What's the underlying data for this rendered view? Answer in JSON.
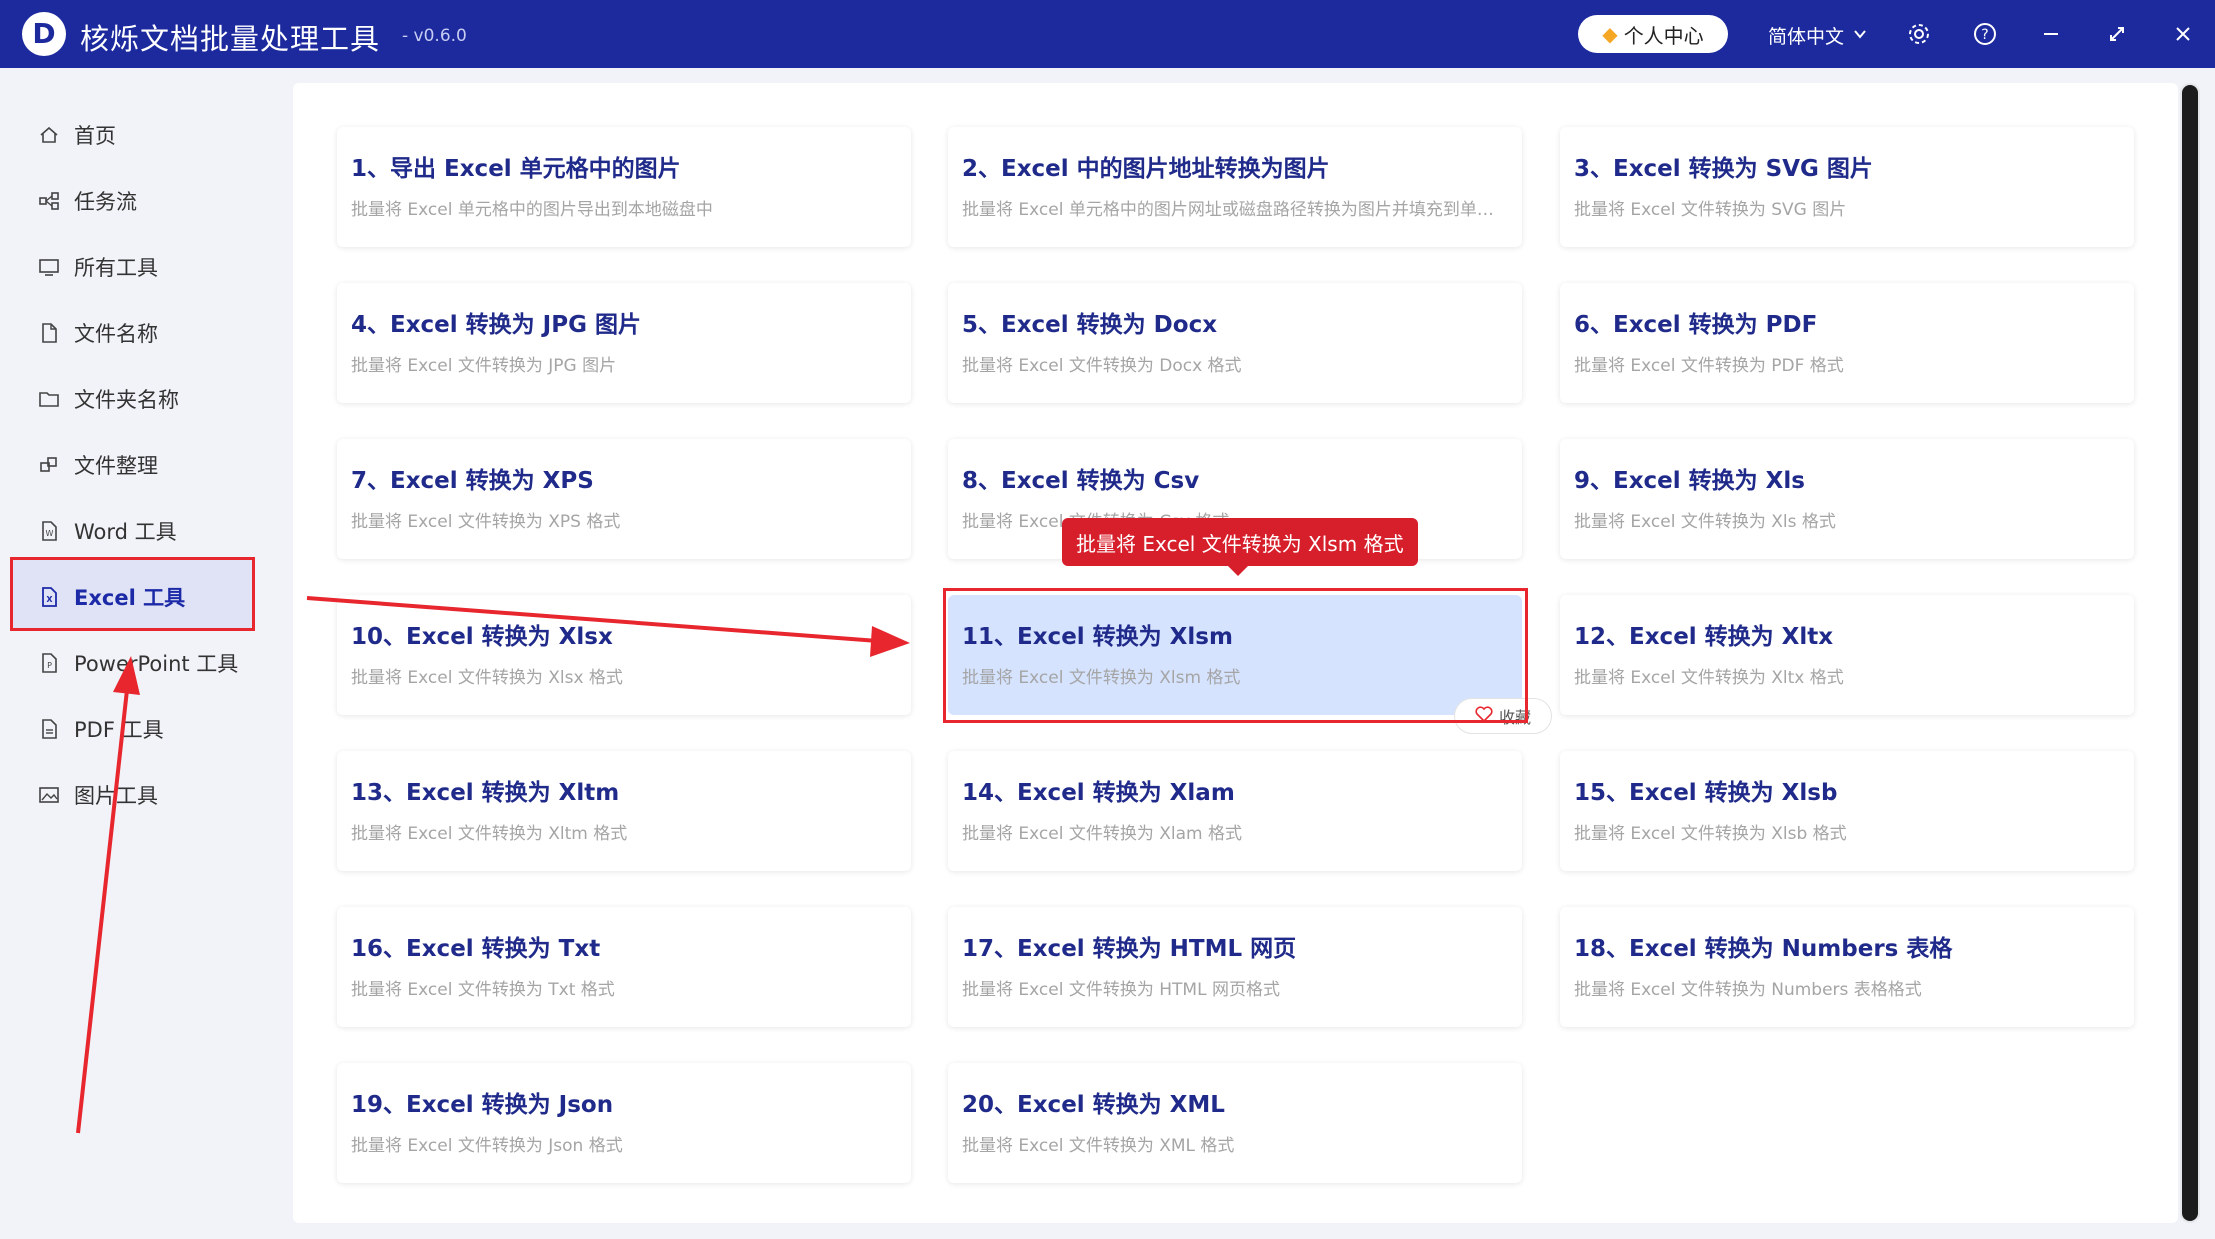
{
  "app": {
    "logo_letter": "D",
    "title": "核烁文档批量处理工具",
    "version": "- v0.6.0",
    "user_center": "个人中心",
    "language": "简体中文"
  },
  "sidebar": {
    "items": [
      {
        "label": "首页",
        "icon": "home-icon"
      },
      {
        "label": "任务流",
        "icon": "workflow-icon"
      },
      {
        "label": "所有工具",
        "icon": "monitor-icon"
      },
      {
        "label": "文件名称",
        "icon": "file-icon"
      },
      {
        "label": "文件夹名称",
        "icon": "folder-icon"
      },
      {
        "label": "文件整理",
        "icon": "organize-icon"
      },
      {
        "label": "Word 工具",
        "icon": "word-icon"
      },
      {
        "label": "Excel 工具",
        "icon": "excel-icon",
        "active": true
      },
      {
        "label": "PowerPoint 工具",
        "icon": "ppt-icon"
      },
      {
        "label": "PDF 工具",
        "icon": "pdf-icon"
      },
      {
        "label": "图片工具",
        "icon": "image-icon"
      }
    ]
  },
  "tools": [
    {
      "title": "1、导出 Excel 单元格中的图片",
      "desc": "批量将 Excel 单元格中的图片导出到本地磁盘中"
    },
    {
      "title": "2、Excel 中的图片地址转换为图片",
      "desc": "批量将 Excel 单元格中的图片网址或磁盘路径转换为图片并填充到单元格中"
    },
    {
      "title": "3、Excel 转换为 SVG 图片",
      "desc": "批量将 Excel 文件转换为 SVG 图片"
    },
    {
      "title": "4、Excel 转换为 JPG 图片",
      "desc": "批量将 Excel 文件转换为 JPG 图片"
    },
    {
      "title": "5、Excel 转换为 Docx",
      "desc": "批量将 Excel 文件转换为 Docx 格式"
    },
    {
      "title": "6、Excel 转换为 PDF",
      "desc": "批量将 Excel 文件转换为 PDF 格式"
    },
    {
      "title": "7、Excel 转换为 XPS",
      "desc": "批量将 Excel 文件转换为 XPS 格式"
    },
    {
      "title": "8、Excel 转换为 Csv",
      "desc": "批量将 Excel 文件转换为 Csv 格式"
    },
    {
      "title": "9、Excel 转换为 Xls",
      "desc": "批量将 Excel 文件转换为 Xls 格式"
    },
    {
      "title": "10、Excel 转换为 Xlsx",
      "desc": "批量将 Excel 文件转换为 Xlsx 格式"
    },
    {
      "title": "11、Excel 转换为 Xlsm",
      "desc": "批量将 Excel 文件转换为 Xlsm 格式",
      "highlighted": true
    },
    {
      "title": "12、Excel 转换为 Xltx",
      "desc": "批量将 Excel 文件转换为 Xltx 格式"
    },
    {
      "title": "13、Excel 转换为 Xltm",
      "desc": "批量将 Excel 文件转换为 Xltm 格式"
    },
    {
      "title": "14、Excel 转换为 Xlam",
      "desc": "批量将 Excel 文件转换为 Xlam 格式"
    },
    {
      "title": "15、Excel 转换为 Xlsb",
      "desc": "批量将 Excel 文件转换为 Xlsb 格式"
    },
    {
      "title": "16、Excel 转换为 Txt",
      "desc": "批量将 Excel 文件转换为 Txt 格式"
    },
    {
      "title": "17、Excel 转换为 HTML 网页",
      "desc": "批量将 Excel 文件转换为 HTML 网页格式"
    },
    {
      "title": "18、Excel 转换为 Numbers 表格",
      "desc": "批量将 Excel 文件转换为 Numbers 表格格式"
    },
    {
      "title": "19、Excel 转换为 Json",
      "desc": "批量将 Excel 文件转换为 Json 格式"
    },
    {
      "title": "20、Excel 转换为 XML",
      "desc": "批量将 Excel 文件转换为 XML 格式"
    }
  ],
  "tooltip": "批量将 Excel 文件转换为 Xlsm 格式",
  "favorite_label": "收藏",
  "colors": {
    "titlebar": "#1c2a9e",
    "highlight_frame": "#e8262e",
    "tooltip": "#d71f2b",
    "card_highlight": "#d5e3ff"
  }
}
